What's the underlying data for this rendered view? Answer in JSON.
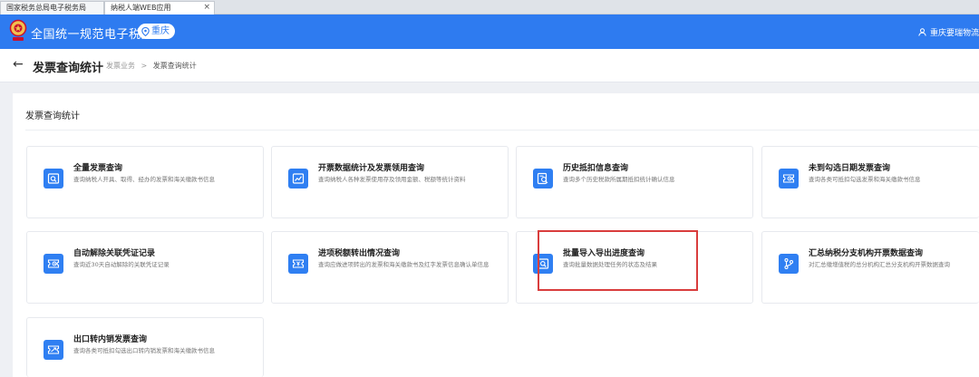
{
  "browser": {
    "tabs": [
      {
        "label": "国家税务总局电子税务局"
      },
      {
        "label": "纳税人端WEB应用"
      }
    ],
    "close_glyph": "×"
  },
  "header": {
    "site_title": "全国统一规范电子税务局",
    "region": "重庆",
    "user": "重庆要瑞物流",
    "emblem_icon": "tax-emblem",
    "accent_color": "#2e7bf0"
  },
  "page": {
    "back_glyph": "←",
    "title": "发票查询统计",
    "breadcrumb": {
      "parent": "发票业务",
      "separator": ">",
      "current": "发票查询统计"
    }
  },
  "section": {
    "title": "发票查询统计"
  },
  "cards": [
    {
      "title": "全量发票查询",
      "desc": "查询纳税人开具、取得、经办的发票和海关缴款书信息",
      "icon": "invoice-search-icon"
    },
    {
      "title": "开票数据统计及发票领用查询",
      "desc": "查询纳税人各种发票使用存及领用金额、税额等统计资料",
      "icon": "chart-line-icon"
    },
    {
      "title": "历史抵扣信息查询",
      "desc": "查询多个历史税款所属期抵扣统计确认信息",
      "icon": "history-search-icon"
    },
    {
      "title": "未到勾选日期发票查询",
      "desc": "查询各类可抵扣勾选发票和海关缴款书信息",
      "icon": "ticket-clock-icon"
    },
    {
      "title": "自动解除关联凭证记录",
      "desc": "查询近30天自动解除的关联凭证记录",
      "icon": "ticket-clock-icon"
    },
    {
      "title": "进项税额转出情况查询",
      "desc": "查询应做进项转出的发票和海关缴款书及红字发票信息确认单信息",
      "icon": "ticket-yen-icon"
    },
    {
      "title": "批量导入导出进度查询",
      "desc": "查询批量数据处理任务的状态及结果",
      "icon": "batch-search-icon"
    },
    {
      "title": "汇总纳税分支机构开票数据查询",
      "desc": "对汇总缴增值税的总分机构汇总分支机构开票数据查询",
      "icon": "branch-icon"
    },
    {
      "title": "出口转内销发票查询",
      "desc": "查询各类可抵扣勾选出口转内销发票和海关缴款书信息",
      "icon": "ticket-export-icon"
    }
  ],
  "highlight_color": "#d93d3d"
}
